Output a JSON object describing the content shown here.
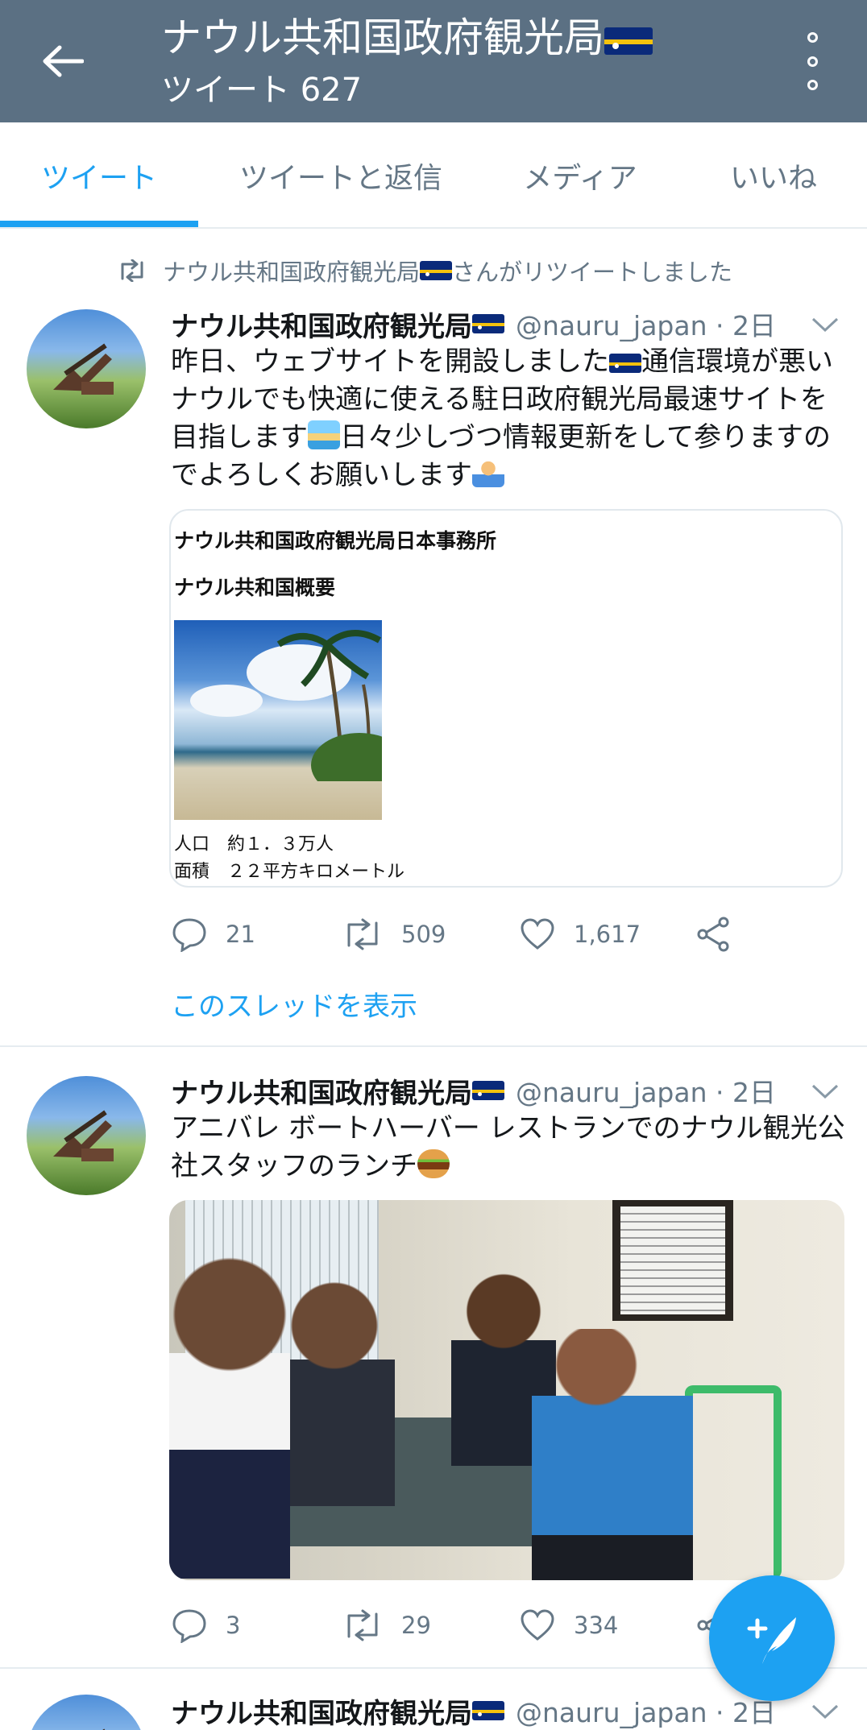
{
  "header": {
    "title": "ナウル共和国政府観光局",
    "subtitle": "ツイート 627"
  },
  "tabs": [
    {
      "label": "ツイート",
      "active": true
    },
    {
      "label": "ツイートと返信",
      "active": false
    },
    {
      "label": "メディア",
      "active": false
    },
    {
      "label": "いいね",
      "active": false
    }
  ],
  "tweets": [
    {
      "retweet_by": "ナウル共和国政府観光局",
      "retweet_suffix": "さんがリツイートしました",
      "name": "ナウル共和国政府観光局",
      "handle_time": "@nauru_japan · 2日",
      "text": [
        "昨日、ウェブサイトを開設しました",
        "通信環境が悪いナウルでも快適に使える駐日政府観光局最速サイトを目指します",
        "日々少しづつ情報更新をして参りますのでよろしくお願いします"
      ],
      "card": {
        "title": "ナウル共和国政府観光局日本事務所",
        "subtitle": "ナウル共和国概要",
        "line1": "人口　約１．３万人",
        "line2": "面積　２２平方キロメートル"
      },
      "replies": "21",
      "retweets": "509",
      "likes": "1,617",
      "thread_link": "このスレッドを表示"
    },
    {
      "name": "ナウル共和国政府観光局",
      "handle_time": "@nauru_japan · 2日",
      "text": "アニバレ ボートハーバー レストランでのナウル観光公社スタッフのランチ",
      "replies": "3",
      "retweets": "29",
      "likes": "334"
    },
    {
      "name": "ナウル共和国政府観光局",
      "handle_time": "@nauru_japan · 2日"
    }
  ],
  "colors": {
    "header_bg": "#5b7083",
    "accent": "#1da1f2",
    "secondary_text": "#657786"
  },
  "icons": [
    "back-arrow-icon",
    "more-vert-icon",
    "retweet-icon",
    "chevron-down-icon",
    "reply-icon",
    "like-icon",
    "share-icon",
    "compose-tweet-icon"
  ]
}
